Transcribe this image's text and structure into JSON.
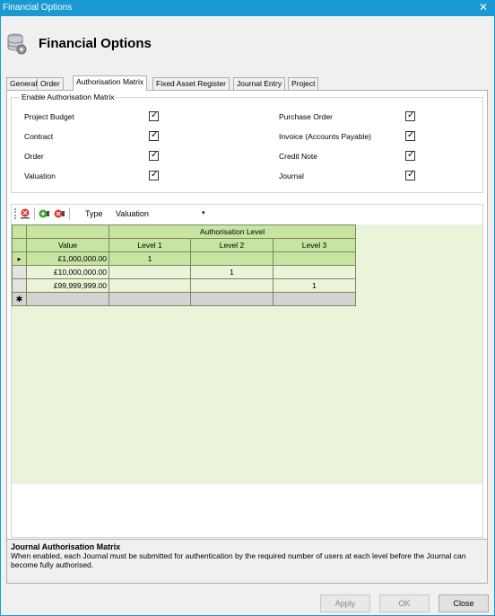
{
  "window": {
    "title": "Financial Options",
    "close_glyph": "✕"
  },
  "header": {
    "title": "Financial Options",
    "icon": "database-gear-icon"
  },
  "tabs": [
    {
      "label": "General"
    },
    {
      "label": "Order"
    },
    {
      "label": "Authorisation Matrix"
    },
    {
      "label": "Fixed Asset Register"
    },
    {
      "label": "Journal Entry"
    },
    {
      "label": "Project"
    }
  ],
  "group": {
    "title": "Enable Authorisation Matrix",
    "left": [
      {
        "label": "Project Budget",
        "checked": true
      },
      {
        "label": "Contract",
        "checked": true
      },
      {
        "label": "Order",
        "checked": true
      },
      {
        "label": "Valuation",
        "checked": true
      }
    ],
    "right": [
      {
        "label": "Purchase Order",
        "checked": true
      },
      {
        "label": "Invoice (Accounts Payable)",
        "checked": true
      },
      {
        "label": "Credit Note",
        "checked": true
      },
      {
        "label": "Journal",
        "checked": true
      }
    ],
    "check_glyph": "✓"
  },
  "toolbar": {
    "type_label": "Type",
    "type_value": "Valuation",
    "caret": "▾"
  },
  "grid": {
    "group_header": "Authorisation Level",
    "columns": [
      "Value",
      "Level 1",
      "Level 2",
      "Level 3"
    ],
    "row_marker": "▸",
    "new_marker": "✱",
    "rows": [
      {
        "value": "£1,000,000.00",
        "l1": "1",
        "l2": "",
        "l3": ""
      },
      {
        "value": "£10,000,000.00",
        "l1": "",
        "l2": "1",
        "l3": ""
      },
      {
        "value": "£99,999,999.00",
        "l1": "",
        "l2": "",
        "l3": "1"
      }
    ]
  },
  "help": {
    "title": "Journal Authorisation Matrix",
    "text": "When enabled, each Journal must be submitted for authentication by the required number of users at each level before the Journal can become fully authorised."
  },
  "buttons": {
    "apply": "Apply",
    "ok": "OK",
    "close": "Close"
  },
  "colors": {
    "titlebar": "#1a9ad3",
    "grid_header": "#c7e4a2",
    "grid_bg": "#eaf4d9"
  }
}
